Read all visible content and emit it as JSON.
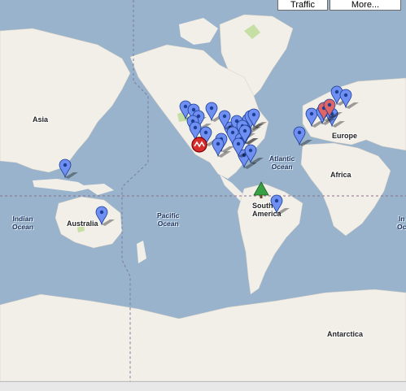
{
  "map": {
    "buttons": {
      "traffic": "Traffic",
      "more": "More..."
    },
    "continent_labels": {
      "asia": "Asia",
      "europe": "Europe",
      "africa": "Africa",
      "australia": "Australia",
      "south_america": "South America",
      "antarctica": "Antarctica"
    },
    "ocean_labels": {
      "atlantic": "Atlantic\nOcean",
      "pacific": "Pacific\nOcean",
      "indian_left": "Indian\nOcean",
      "indian_right": "In\nOc"
    },
    "colors": {
      "water": "#99b3cc",
      "land": "#f2efe9",
      "park": "#c6dfa5",
      "marker": "#6f8ff2",
      "marker_red": "#e06565",
      "tree_marker": "#38a045",
      "gridline": "#7a7aa0"
    },
    "markers": [
      {
        "kind": "pin",
        "location": "Southeast Asia"
      },
      {
        "kind": "pin",
        "location": "Eastern Australia"
      },
      {
        "kind": "pin",
        "location": "Western Canada"
      },
      {
        "kind": "pin",
        "location": "Central Canada"
      },
      {
        "kind": "pin",
        "location": "US Pacific Northwest"
      },
      {
        "kind": "pin",
        "location": "US Pacific Northwest"
      },
      {
        "kind": "pin",
        "location": "US West"
      },
      {
        "kind": "pin",
        "location": "US West"
      },
      {
        "kind": "pin",
        "location": "US West"
      },
      {
        "kind": "pin",
        "location": "US Southwest"
      },
      {
        "kind": "pin",
        "location": "US Southwest"
      },
      {
        "kind": "pin",
        "location": "US Midwest"
      },
      {
        "kind": "pin",
        "location": "US Midwest"
      },
      {
        "kind": "pin",
        "location": "US Midwest"
      },
      {
        "kind": "pin",
        "location": "US Great Lakes"
      },
      {
        "kind": "pin",
        "location": "US Great Lakes"
      },
      {
        "kind": "pin",
        "location": "US Northeast"
      },
      {
        "kind": "pin",
        "location": "US Northeast"
      },
      {
        "kind": "pin",
        "location": "US East"
      },
      {
        "kind": "pin",
        "location": "US East"
      },
      {
        "kind": "pin",
        "location": "US South"
      },
      {
        "kind": "pin",
        "location": "US Southeast"
      },
      {
        "kind": "pin",
        "location": "US Southeast"
      },
      {
        "kind": "pin",
        "location": "Florida"
      },
      {
        "kind": "pin",
        "location": "Texas"
      },
      {
        "kind": "pin",
        "location": "Brazil"
      },
      {
        "kind": "pin",
        "location": "Portugal"
      },
      {
        "kind": "pin",
        "location": "UK"
      },
      {
        "kind": "pin",
        "location": "Germany"
      },
      {
        "kind": "pin",
        "location": "Italy"
      },
      {
        "kind": "pin",
        "location": "Scandinavia"
      },
      {
        "kind": "pin",
        "location": "Scandinavia"
      },
      {
        "kind": "pin_red",
        "location": "Northern Europe"
      },
      {
        "kind": "pin_red",
        "location": "Northern Europe"
      },
      {
        "kind": "cluster",
        "location": "California"
      },
      {
        "kind": "tree",
        "location": "Northern South America"
      }
    ]
  }
}
